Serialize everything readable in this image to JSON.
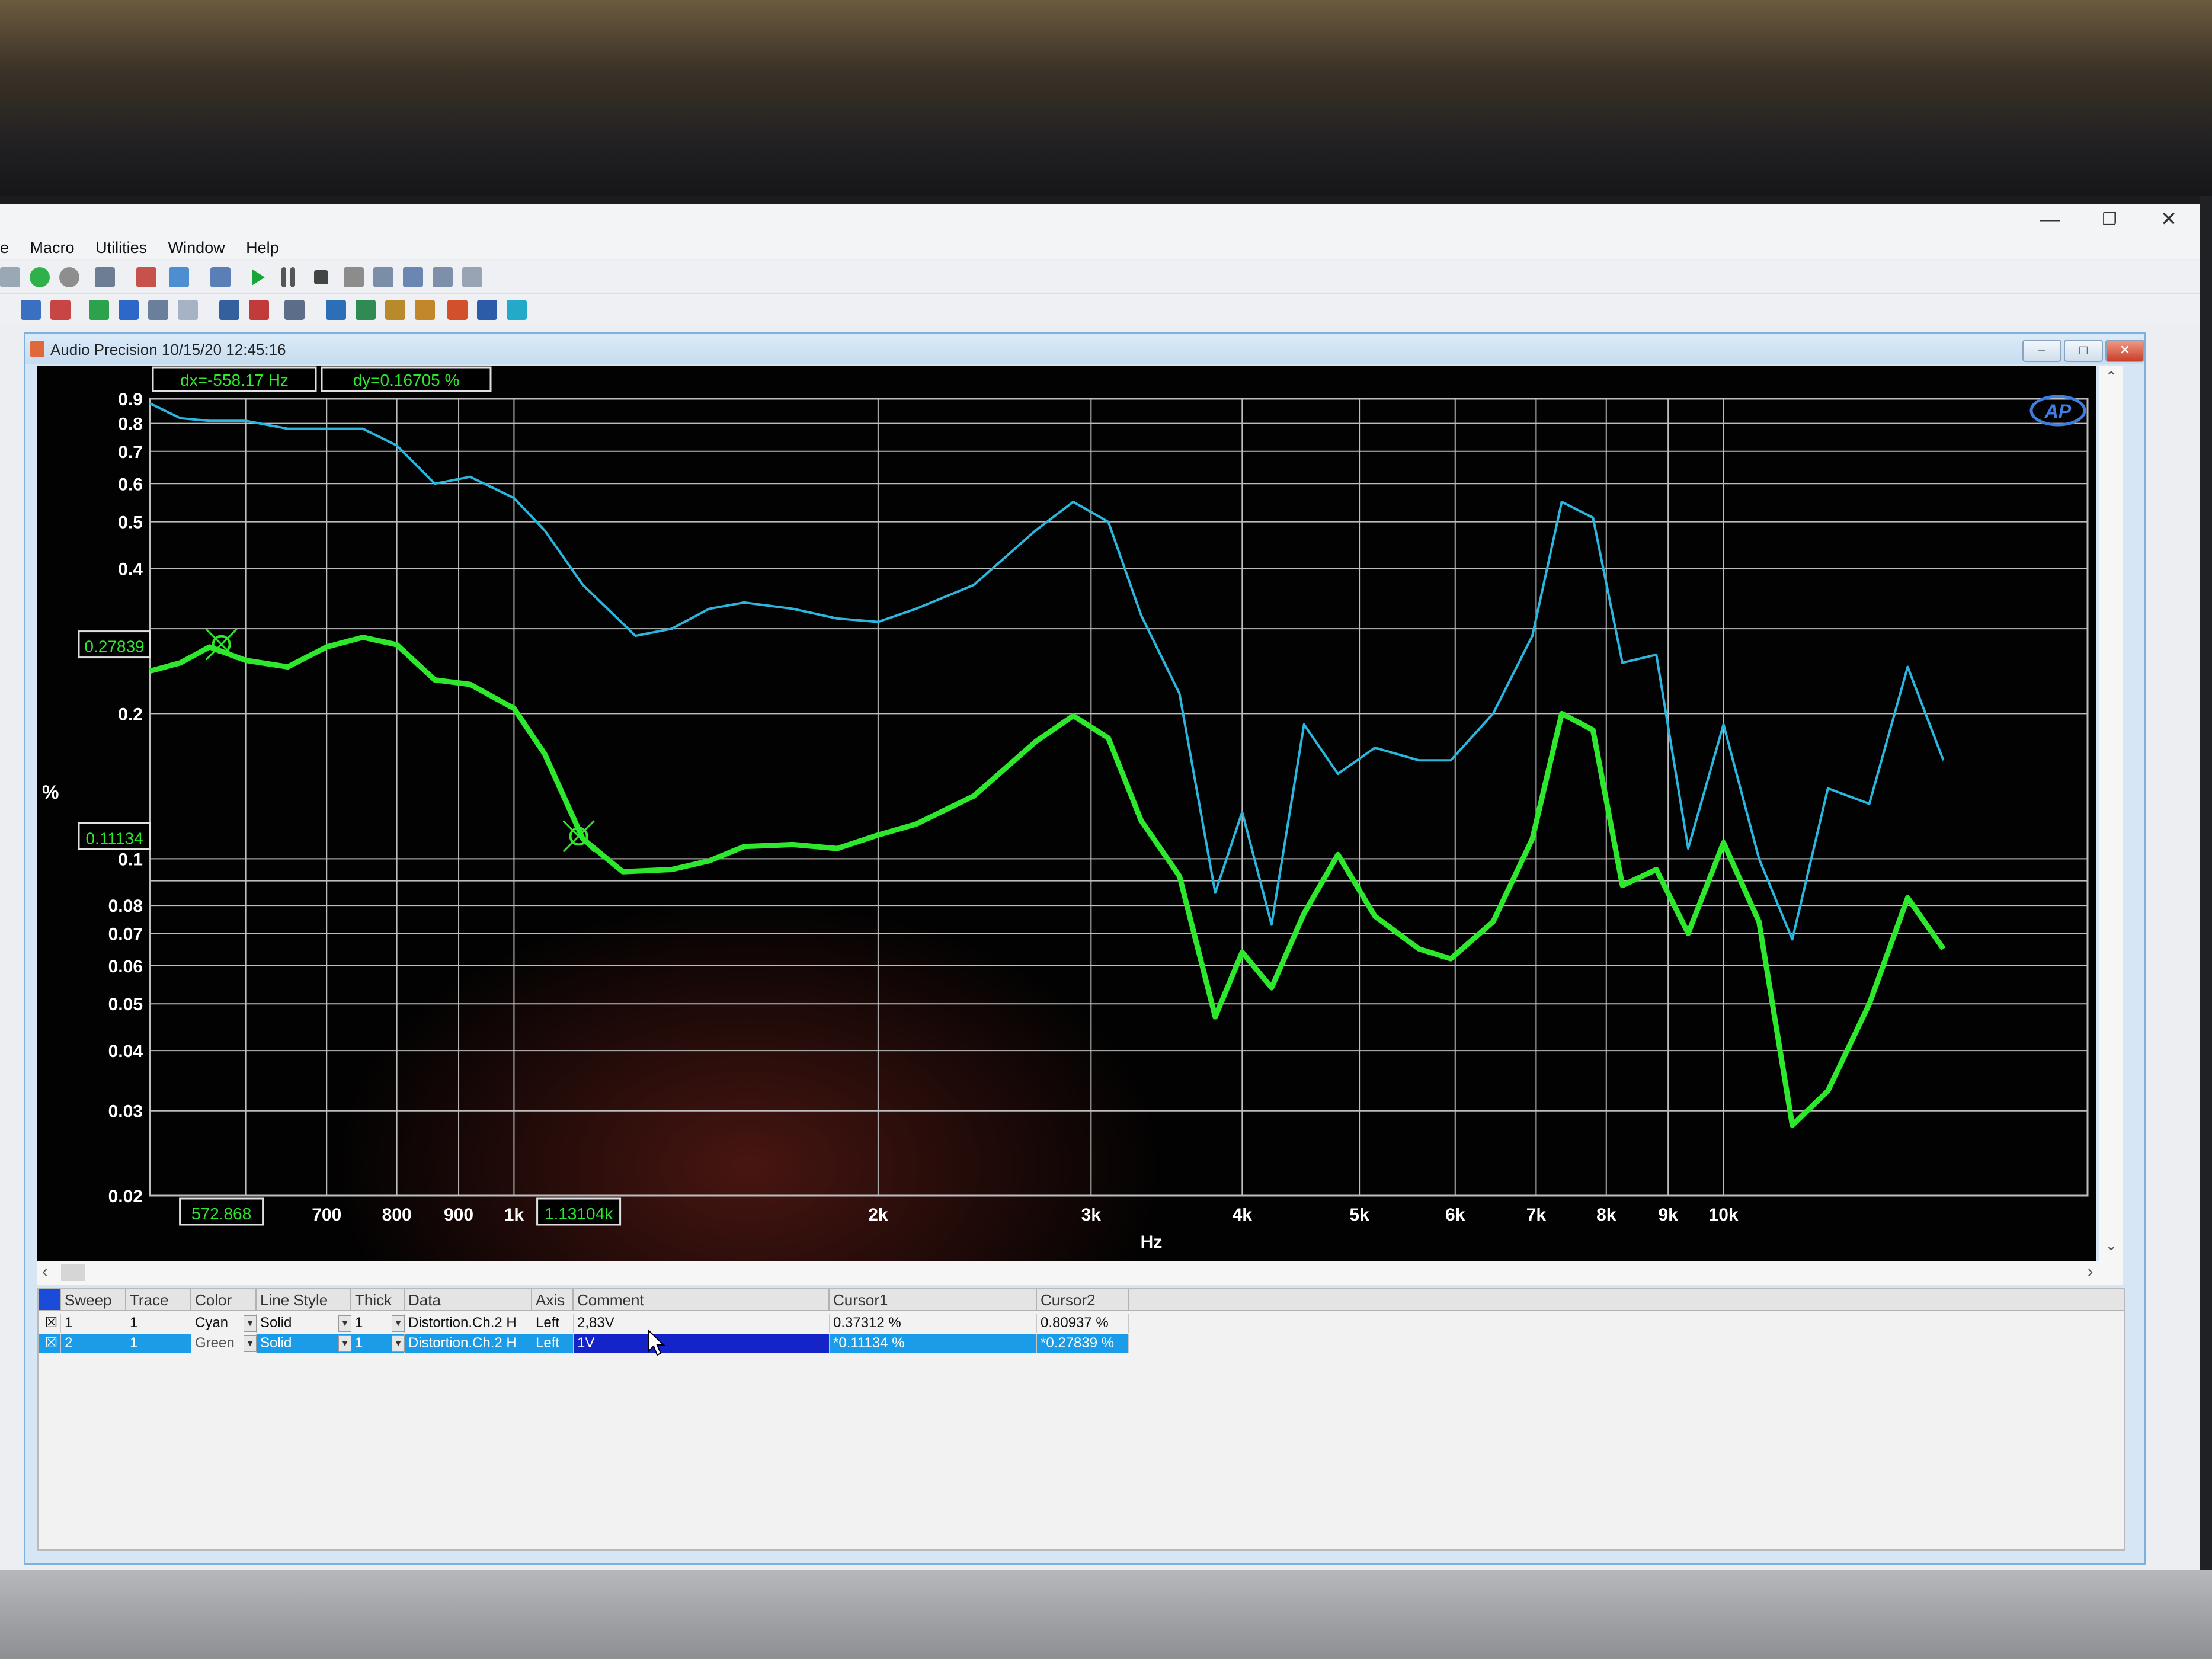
{
  "window": {
    "menu": [
      "e",
      "Macro",
      "Utilities",
      "Window",
      "Help"
    ],
    "controls": {
      "minimize": "—",
      "restore": "❐",
      "close": "✕"
    }
  },
  "graph_window": {
    "title": "Audio Precision  10/15/20 12:45:16",
    "buttons": {
      "minimize": "–",
      "maximize": "□",
      "close": "✕"
    },
    "logo": "AP"
  },
  "cursor_readouts": {
    "dx": "dx=-558.17  Hz",
    "dy": "dy=0.16705  %",
    "y_cursor2": "0.27839",
    "y_cursor1": "0.11134",
    "x_cursor2": "572.868",
    "x_cursor1": "1.13104k"
  },
  "chart_data": {
    "type": "line",
    "xscale": "log",
    "yscale": "log",
    "xlim": [
      500,
      20000
    ],
    "ylim": [
      0.02,
      0.9
    ],
    "xlabel": "Hz",
    "ylabel": "%",
    "grid": true,
    "x_ticks": [
      {
        "v": 700,
        "label": "700"
      },
      {
        "v": 800,
        "label": "800"
      },
      {
        "v": 900,
        "label": "900"
      },
      {
        "v": 1000,
        "label": "1k"
      },
      {
        "v": 2000,
        "label": "2k"
      },
      {
        "v": 3000,
        "label": "3k"
      },
      {
        "v": 4000,
        "label": "4k"
      },
      {
        "v": 5000,
        "label": "5k"
      },
      {
        "v": 6000,
        "label": "6k"
      },
      {
        "v": 7000,
        "label": "7k"
      },
      {
        "v": 8000,
        "label": "8k"
      },
      {
        "v": 9000,
        "label": "9k"
      },
      {
        "v": 10000,
        "label": "10k"
      }
    ],
    "x_grid": [
      600,
      700,
      800,
      900,
      1000,
      2000,
      3000,
      4000,
      5000,
      6000,
      7000,
      8000,
      9000,
      10000,
      20000
    ],
    "y_ticks": [
      {
        "v": 0.9,
        "label": "0.9"
      },
      {
        "v": 0.8,
        "label": "0.8"
      },
      {
        "v": 0.7,
        "label": "0.7"
      },
      {
        "v": 0.6,
        "label": "0.6"
      },
      {
        "v": 0.5,
        "label": "0.5"
      },
      {
        "v": 0.4,
        "label": "0.4"
      },
      {
        "v": 0.2,
        "label": "0.2"
      },
      {
        "v": 0.1,
        "label": "0.1"
      },
      {
        "v": 0.08,
        "label": "0.08"
      },
      {
        "v": 0.07,
        "label": "0.07"
      },
      {
        "v": 0.06,
        "label": "0.06"
      },
      {
        "v": 0.05,
        "label": "0.05"
      },
      {
        "v": 0.04,
        "label": "0.04"
      },
      {
        "v": 0.03,
        "label": "0.03"
      },
      {
        "v": 0.02,
        "label": "0.02"
      }
    ],
    "y_grid": [
      0.9,
      0.8,
      0.7,
      0.6,
      0.5,
      0.4,
      0.3,
      0.2,
      0.1,
      0.09,
      0.08,
      0.07,
      0.06,
      0.05,
      0.04,
      0.03
    ],
    "series": [
      {
        "name": "2,83V",
        "color": "#2bb6dd",
        "points": [
          [
            500,
            0.88
          ],
          [
            530,
            0.82
          ],
          [
            560,
            0.81
          ],
          [
            600,
            0.81
          ],
          [
            650,
            0.78
          ],
          [
            700,
            0.78
          ],
          [
            750,
            0.78
          ],
          [
            800,
            0.72
          ],
          [
            860,
            0.6
          ],
          [
            920,
            0.62
          ],
          [
            1000,
            0.56
          ],
          [
            1060,
            0.48
          ],
          [
            1140,
            0.37
          ],
          [
            1260,
            0.29
          ],
          [
            1350,
            0.3
          ],
          [
            1450,
            0.33
          ],
          [
            1550,
            0.34
          ],
          [
            1700,
            0.33
          ],
          [
            1850,
            0.315
          ],
          [
            2000,
            0.31
          ],
          [
            2150,
            0.33
          ],
          [
            2400,
            0.37
          ],
          [
            2700,
            0.48
          ],
          [
            2900,
            0.55
          ],
          [
            3100,
            0.5
          ],
          [
            3300,
            0.32
          ],
          [
            3550,
            0.22
          ],
          [
            3800,
            0.085
          ],
          [
            4000,
            0.125
          ],
          [
            4230,
            0.073
          ],
          [
            4500,
            0.19
          ],
          [
            4800,
            0.15
          ],
          [
            5150,
            0.17
          ],
          [
            5600,
            0.16
          ],
          [
            5950,
            0.16
          ],
          [
            6450,
            0.2
          ],
          [
            6950,
            0.29
          ],
          [
            7350,
            0.55
          ],
          [
            7800,
            0.51
          ],
          [
            8250,
            0.255
          ],
          [
            8800,
            0.265
          ],
          [
            9350,
            0.105
          ],
          [
            10000,
            0.19
          ],
          [
            10700,
            0.1
          ],
          [
            11400,
            0.068
          ],
          [
            12200,
            0.14
          ],
          [
            13200,
            0.13
          ],
          [
            14200,
            0.25
          ],
          [
            15200,
            0.16
          ]
        ]
      },
      {
        "name": "1V",
        "color": "#2de82d",
        "points": [
          [
            500,
            0.245
          ],
          [
            530,
            0.255
          ],
          [
            560,
            0.275
          ],
          [
            600,
            0.258
          ],
          [
            650,
            0.25
          ],
          [
            700,
            0.275
          ],
          [
            750,
            0.288
          ],
          [
            800,
            0.278
          ],
          [
            860,
            0.235
          ],
          [
            920,
            0.23
          ],
          [
            1000,
            0.205
          ],
          [
            1060,
            0.165
          ],
          [
            1140,
            0.11
          ],
          [
            1230,
            0.094
          ],
          [
            1350,
            0.095
          ],
          [
            1450,
            0.099
          ],
          [
            1550,
            0.106
          ],
          [
            1700,
            0.107
          ],
          [
            1850,
            0.105
          ],
          [
            2000,
            0.112
          ],
          [
            2150,
            0.118
          ],
          [
            2400,
            0.135
          ],
          [
            2700,
            0.175
          ],
          [
            2900,
            0.198
          ],
          [
            3100,
            0.178
          ],
          [
            3300,
            0.12
          ],
          [
            3550,
            0.092
          ],
          [
            3800,
            0.047
          ],
          [
            4000,
            0.064
          ],
          [
            4230,
            0.054
          ],
          [
            4500,
            0.077
          ],
          [
            4800,
            0.102
          ],
          [
            5150,
            0.076
          ],
          [
            5600,
            0.065
          ],
          [
            5950,
            0.062
          ],
          [
            6450,
            0.074
          ],
          [
            6950,
            0.11
          ],
          [
            7350,
            0.2
          ],
          [
            7800,
            0.185
          ],
          [
            8250,
            0.088
          ],
          [
            8800,
            0.095
          ],
          [
            9350,
            0.07
          ],
          [
            10000,
            0.108
          ],
          [
            10700,
            0.074
          ],
          [
            11400,
            0.028
          ],
          [
            12200,
            0.033
          ],
          [
            13200,
            0.05
          ],
          [
            14200,
            0.083
          ],
          [
            15200,
            0.065
          ]
        ]
      }
    ],
    "cursors": [
      {
        "x": 572.868,
        "y": 0.27839
      },
      {
        "x": 1131.04,
        "y": 0.11134
      }
    ]
  },
  "legend_table": {
    "headers": [
      "Sweep",
      "Trace",
      "Color",
      "Line Style",
      "Thick",
      "Data",
      "Axis",
      "Comment",
      "Cursor1",
      "Cursor2"
    ],
    "rows": [
      {
        "sweep": "1",
        "trace": "1",
        "color": "Cyan",
        "style": "Solid",
        "thick": "1",
        "data": "Distortion.Ch.2 H",
        "axis": "Left",
        "comment": "2,83V",
        "cursor1": "0.37312  %",
        "cursor2": "0.80937  %"
      },
      {
        "sweep": "2",
        "trace": "1",
        "color": "Green",
        "style": "Solid",
        "thick": "1",
        "data": "Distortion.Ch.2 H",
        "axis": "Left",
        "comment": "1V",
        "cursor1": "*0.11134  %",
        "cursor2": "*0.27839  %"
      }
    ]
  }
}
